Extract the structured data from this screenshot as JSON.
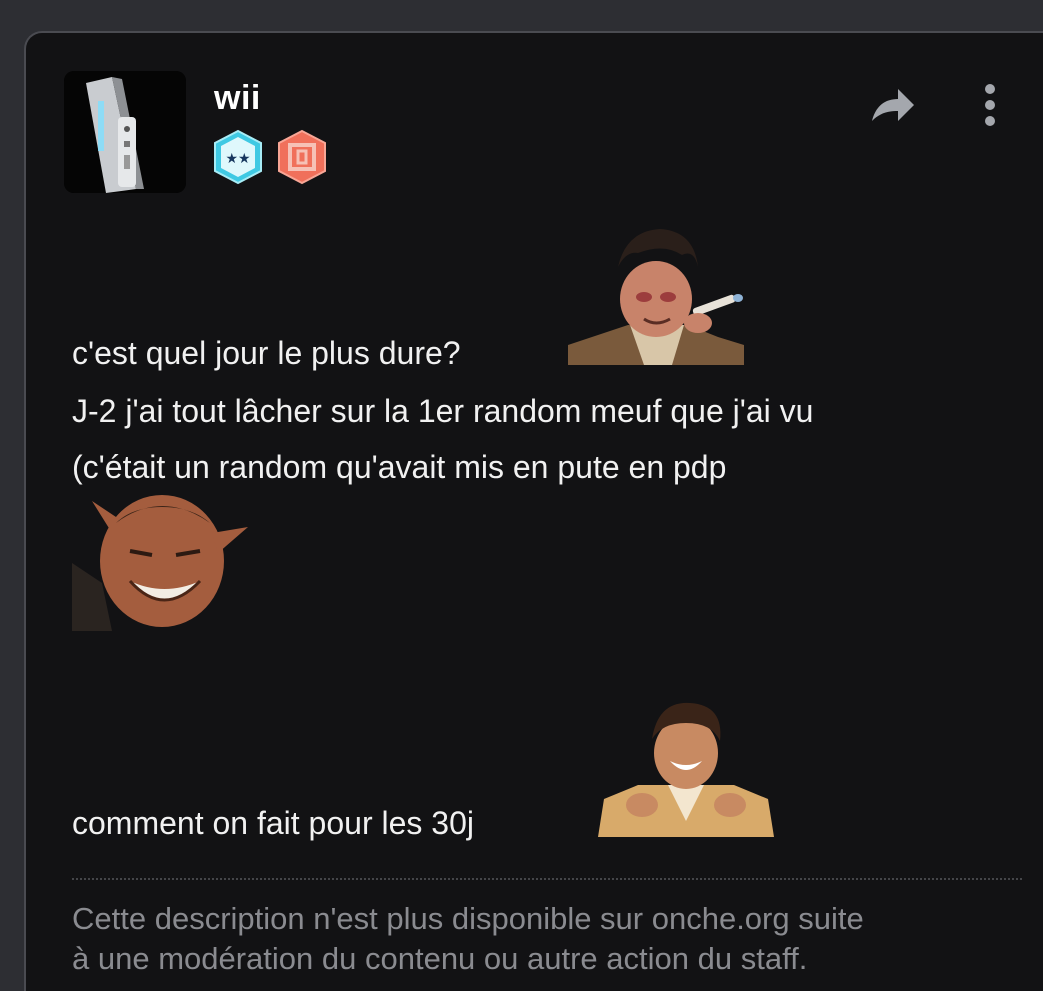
{
  "post": {
    "username": "wii",
    "avatar_icon": "wii-console-avatar",
    "badges": [
      {
        "icon": "two-stars-badge-icon",
        "color": "#3fc9e3"
      },
      {
        "icon": "square-glyph-badge-icon",
        "color": "#f0705b"
      }
    ],
    "actions": {
      "share_icon": "share-arrow-icon",
      "more_icon": "vertical-dots-icon"
    },
    "lines": [
      "c'est quel jour le plus dure?",
      "J-2 j'ai tout lâcher sur la 1er random meuf que j'ai vu",
      "(c'était un random qu'avait mis en pute en pdp",
      "comment on fait pour les 30j"
    ],
    "stickers": [
      "smoking-man-sticker",
      "devil-grin-sticker",
      "laughing-man-sticker"
    ],
    "description": [
      "Cette description n'est plus disponible sur onche.org suite",
      "à une modération du contenu ou autre action du staff."
    ]
  }
}
